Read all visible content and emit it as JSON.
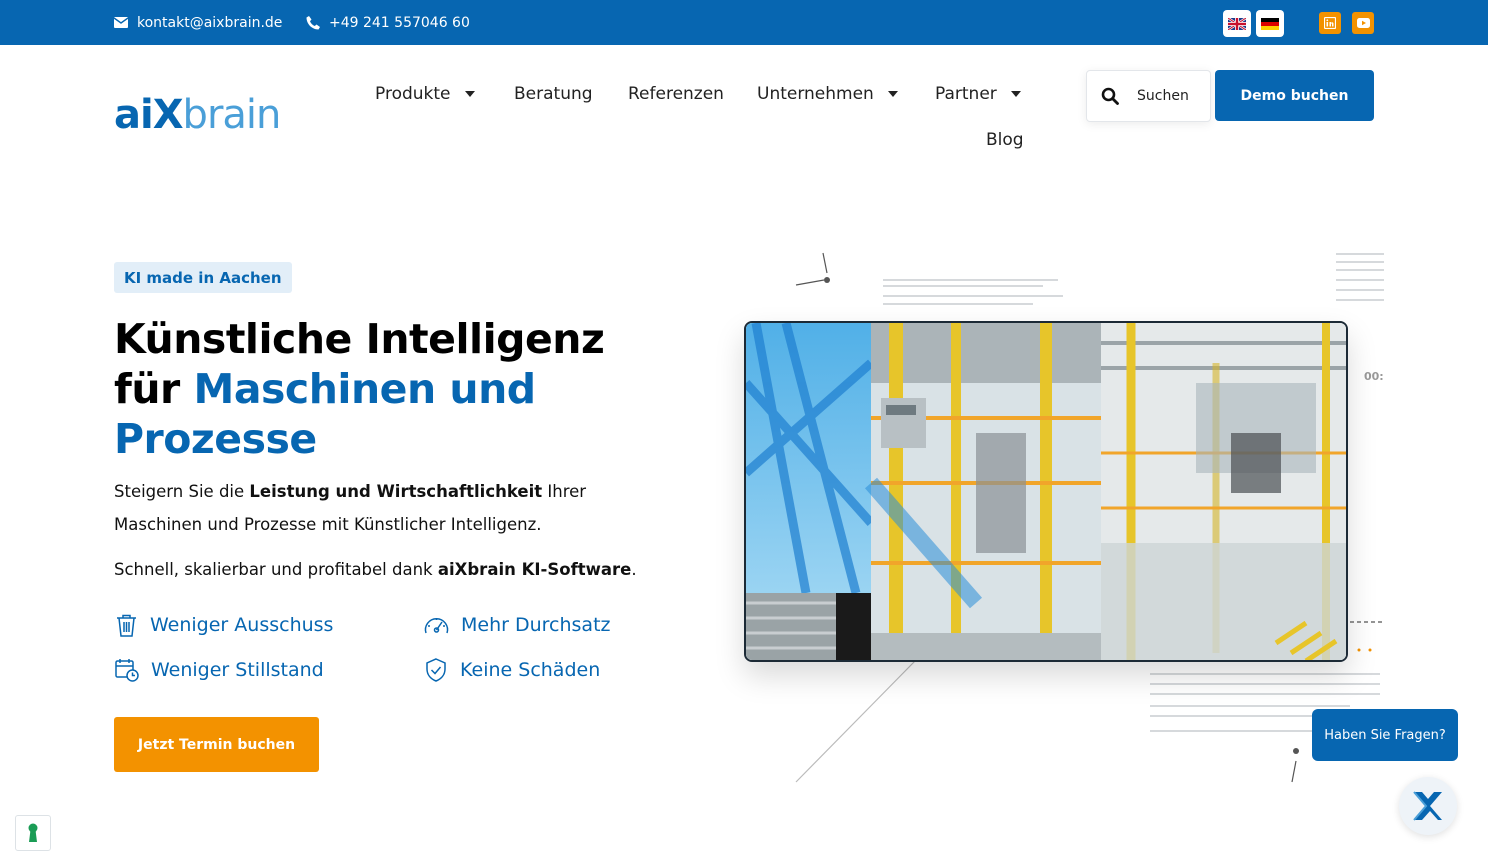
{
  "topbar": {
    "email": "kontakt@aixbrain.de",
    "phone": "+49 241 557046 60",
    "languages": [
      {
        "code": "en",
        "icon": "uk-flag-icon"
      },
      {
        "code": "de",
        "icon": "germany-flag-icon"
      }
    ],
    "social": [
      {
        "name": "LinkedIn",
        "icon": "linkedin-icon"
      },
      {
        "name": "YouTube",
        "icon": "youtube-icon"
      }
    ],
    "background": "#0766b1"
  },
  "logo": {
    "part1": "ai",
    "part2": "X",
    "part3": "brain"
  },
  "nav": {
    "items": [
      {
        "label": "Produkte",
        "has_dropdown": true
      },
      {
        "label": "Beratung",
        "has_dropdown": false
      },
      {
        "label": "Referenzen",
        "has_dropdown": false
      },
      {
        "label": "Unternehmen",
        "has_dropdown": true
      },
      {
        "label": "Partner",
        "has_dropdown": true
      },
      {
        "label": "Blog",
        "has_dropdown": false
      }
    ],
    "search_label": "Suchen",
    "demo_label": "Demo buchen"
  },
  "hero": {
    "badge": "KI made in Aachen",
    "headline_line1": "Künstliche Intelligenz",
    "headline_line2_black": "für ",
    "headline_line2_blue": "Maschinen und",
    "headline_line3_blue": "Prozesse",
    "lead_pre": "Steigern Sie die ",
    "lead_bold": "Leistung und Wirtschaftlichkeit",
    "lead_post": " Ihrer Maschinen und Prozesse mit Künstlicher Intelligenz.",
    "lead2_pre": "Schnell, skalierbar und profitabel dank ",
    "lead2_bold": "aiXbrain KI-Software",
    "lead2_post": ".",
    "features": [
      {
        "label": "Weniger Ausschuss",
        "icon": "trash-icon"
      },
      {
        "label": "Mehr Durchsatz",
        "icon": "speedometer-icon"
      },
      {
        "label": "Weniger Stillstand",
        "icon": "calendar-clock-icon"
      },
      {
        "label": "Keine Schäden",
        "icon": "shield-check-icon"
      }
    ],
    "cta_label": "Jetzt Termin buchen",
    "image_label": "00:"
  },
  "chat": {
    "bubble": "Haben Sie Fragen?"
  },
  "colors": {
    "primary": "#0766b1",
    "accent": "#f39200",
    "light_blue": "#4a9fd8"
  }
}
